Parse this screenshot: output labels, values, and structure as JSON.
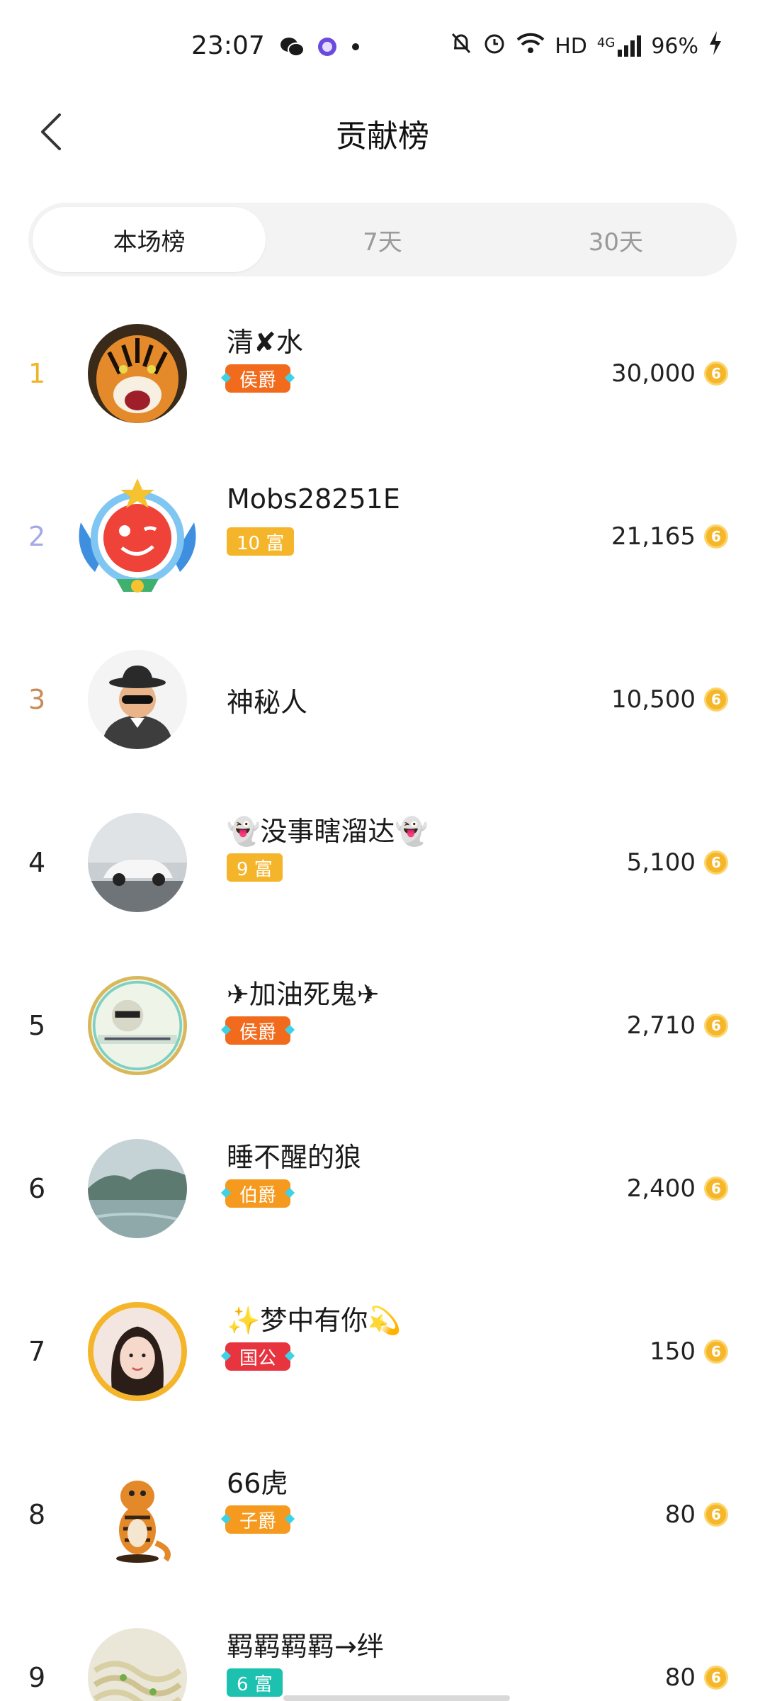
{
  "status_bar": {
    "time": "23:07",
    "hd": "HD",
    "network": "4G",
    "battery": "96%"
  },
  "header": {
    "title": "贡献榜"
  },
  "tabs": [
    {
      "label": "本场榜",
      "active": true
    },
    {
      "label": "7天",
      "active": false
    },
    {
      "label": "30天",
      "active": false
    }
  ],
  "rank_colors": {
    "1": "#f0b429",
    "2": "#a7a9e6",
    "3": "#c98a55"
  },
  "coin_icon": "coin-icon",
  "list": [
    {
      "rank": "1",
      "name": "清✘水",
      "badge": "侯爵",
      "badge_type": "title",
      "badge_color": "#f26b1d",
      "score": "30,000",
      "avatar": "tiger"
    },
    {
      "rank": "2",
      "name": "Mobs28251E",
      "badge": "10 富",
      "badge_type": "level",
      "badge_color": "#f5b52b",
      "score": "21,165",
      "avatar": "wink-face"
    },
    {
      "rank": "3",
      "name": "神秘人",
      "badge": "",
      "badge_type": "none",
      "badge_color": "",
      "score": "10,500",
      "avatar": "mystery-man"
    },
    {
      "rank": "4",
      "name": "👻没事瞎溜达👻",
      "badge": "9 富",
      "badge_type": "level",
      "badge_color": "#f5b52b",
      "score": "5,100",
      "avatar": "white-car"
    },
    {
      "rank": "5",
      "name": "✈加油死鬼✈",
      "badge": "侯爵",
      "badge_type": "title",
      "badge_color": "#f26b1d",
      "score": "2,710",
      "avatar": "meme-dog"
    },
    {
      "rank": "6",
      "name": "睡不醒的狼",
      "badge": "伯爵",
      "badge_type": "title",
      "badge_color": "#f59a1e",
      "score": "2,400",
      "avatar": "misty-river"
    },
    {
      "rank": "7",
      "name": "✨梦中有你💫",
      "badge": "国公",
      "badge_type": "title",
      "badge_color": "#e8343f",
      "score": "150",
      "avatar": "woman-photo"
    },
    {
      "rank": "8",
      "name": "66虎",
      "badge": "子爵",
      "badge_type": "title",
      "badge_color": "#f59a1e",
      "score": "80",
      "avatar": "tiger-cartoon"
    },
    {
      "rank": "9",
      "name": "羁羁羁羁→绊",
      "badge": "6 富",
      "badge_type": "level",
      "badge_color": "#1cc1b0",
      "score": "80",
      "avatar": "noodles"
    }
  ]
}
